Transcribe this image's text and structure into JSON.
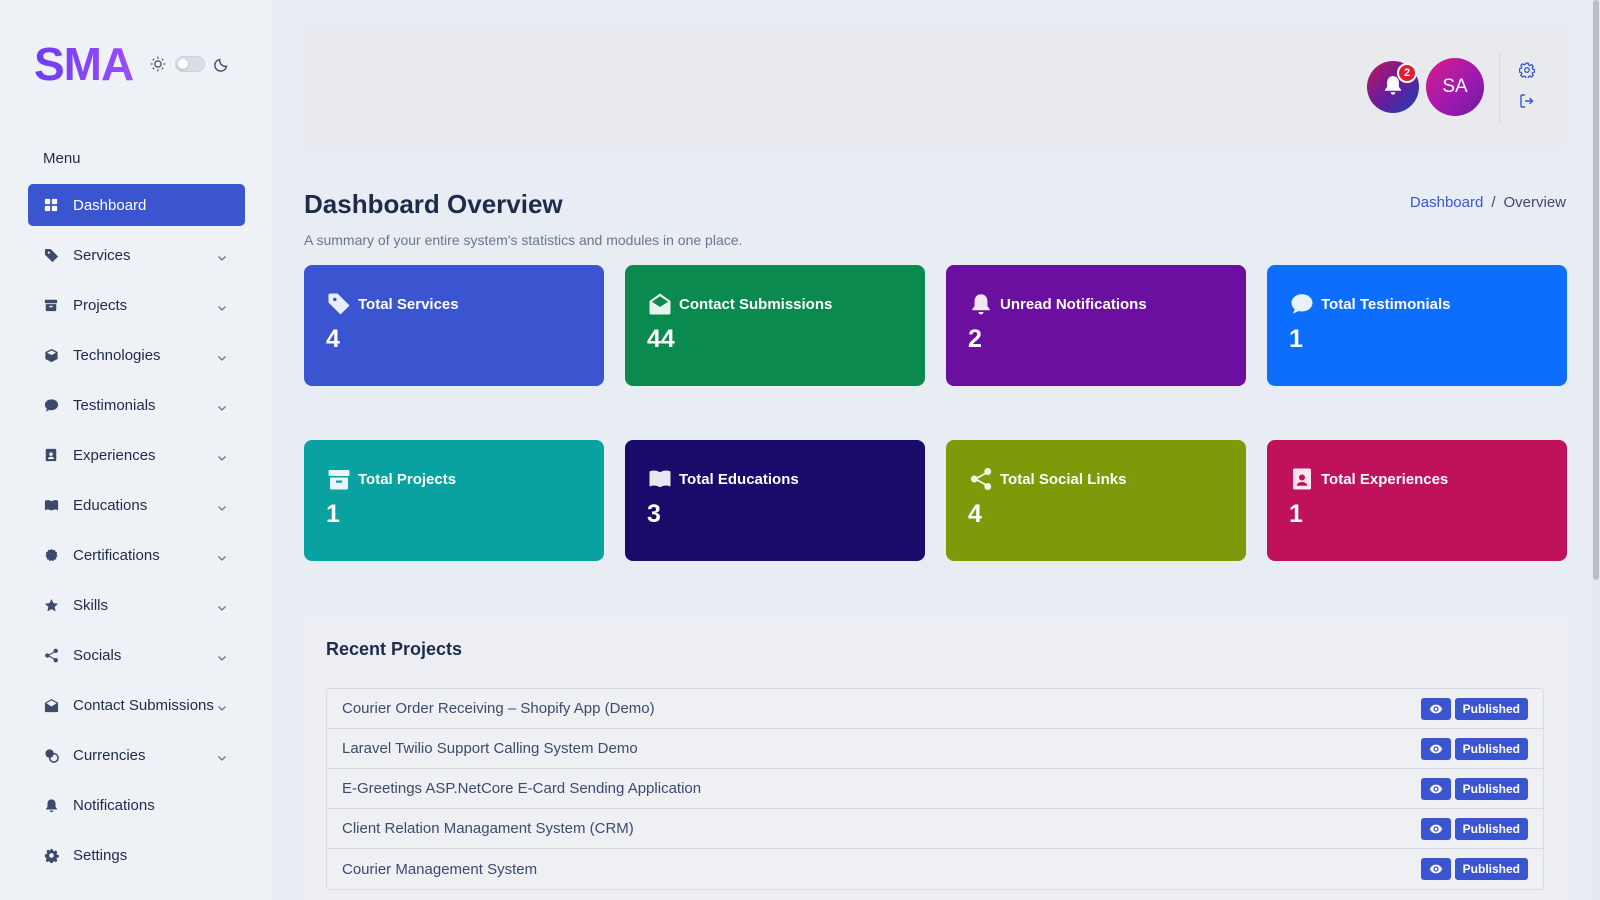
{
  "brand": {
    "logo": "SMA"
  },
  "theme": {
    "light_icon": "sun-icon",
    "dark_icon": "moon-icon"
  },
  "sidebar": {
    "menu_title": "Menu",
    "items": [
      {
        "label": "Dashboard",
        "icon": "grid-icon",
        "active": true,
        "has_children": false
      },
      {
        "label": "Services",
        "icon": "tag-icon",
        "has_children": true
      },
      {
        "label": "Projects",
        "icon": "archive-icon",
        "has_children": true
      },
      {
        "label": "Technologies",
        "icon": "cube-icon",
        "has_children": true
      },
      {
        "label": "Testimonials",
        "icon": "chat-icon",
        "has_children": true
      },
      {
        "label": "Experiences",
        "icon": "id-badge-icon",
        "has_children": true
      },
      {
        "label": "Educations",
        "icon": "book-icon",
        "has_children": true
      },
      {
        "label": "Certifications",
        "icon": "certificate-icon",
        "has_children": true
      },
      {
        "label": "Skills",
        "icon": "star-icon",
        "has_children": true
      },
      {
        "label": "Socials",
        "icon": "share-icon",
        "has_children": true
      },
      {
        "label": "Contact Submissions",
        "icon": "envelope-icon",
        "has_children": true
      },
      {
        "label": "Currencies",
        "icon": "coins-icon",
        "has_children": true
      },
      {
        "label": "Notifications",
        "icon": "bell-icon",
        "has_children": false
      },
      {
        "label": "Settings",
        "icon": "gear-icon",
        "has_children": false
      }
    ]
  },
  "topbar": {
    "notification_count": "2",
    "avatar_initials": "SA"
  },
  "header": {
    "title": "Dashboard Overview",
    "subtitle": "A summary of your entire system's statistics and modules in one place.",
    "breadcrumb": {
      "link": "Dashboard",
      "separator": "/",
      "current": "Overview"
    }
  },
  "cards": [
    {
      "label": "Total Services",
      "value": "4",
      "icon": "tag-icon",
      "color": "#3b55d1"
    },
    {
      "label": "Contact Submissions",
      "value": "44",
      "icon": "envelope-open-icon",
      "color": "#0a8a4f"
    },
    {
      "label": "Unread Notifications",
      "value": "2",
      "icon": "bell-icon",
      "color": "#6a0fa0"
    },
    {
      "label": "Total Testimonials",
      "value": "1",
      "icon": "chat-icon",
      "color": "#0d6efd"
    },
    {
      "label": "Total Projects",
      "value": "1",
      "icon": "archive-icon",
      "color": "#0aa1a1"
    },
    {
      "label": "Total Educations",
      "value": "3",
      "icon": "book-icon",
      "color": "#1a0a6a"
    },
    {
      "label": "Total Social Links",
      "value": "4",
      "icon": "share-icon",
      "color": "#7c9a0a"
    },
    {
      "label": "Total Experiences",
      "value": "1",
      "icon": "id-badge-icon",
      "color": "#c0125a"
    }
  ],
  "recent_projects": {
    "title": "Recent Projects",
    "rows": [
      {
        "name": "Courier Order Receiving – Shopify App (Demo)",
        "status": "Published"
      },
      {
        "name": "Laravel Twilio Support Calling System Demo",
        "status": "Published"
      },
      {
        "name": "E-Greetings ASP.NetCore E-Card Sending Application",
        "status": "Published"
      },
      {
        "name": "Client Relation Managament System (CRM)",
        "status": "Published"
      },
      {
        "name": "Courier Management System",
        "status": "Published"
      }
    ]
  }
}
